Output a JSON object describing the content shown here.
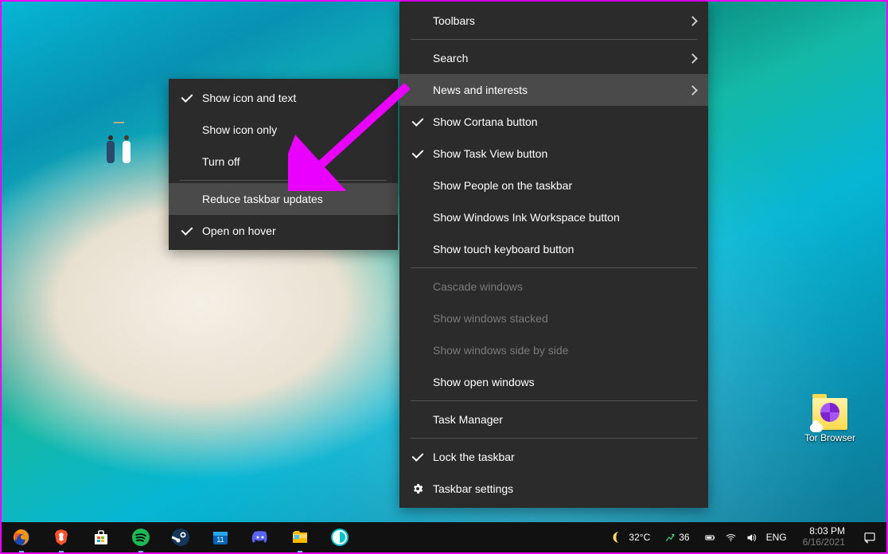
{
  "desktop": {
    "icon_label": "Tor Browser"
  },
  "submenu": {
    "items": [
      {
        "label": "Show icon and text",
        "checked": true
      },
      {
        "label": "Show icon only",
        "checked": false
      },
      {
        "label": "Turn off",
        "checked": false
      }
    ],
    "reduce": "Reduce taskbar updates",
    "hover": "Open on hover"
  },
  "mainmenu": {
    "toolbars": "Toolbars",
    "search": "Search",
    "news": "News and interests",
    "cortana": "Show Cortana button",
    "taskview": "Show Task View button",
    "people": "Show People on the taskbar",
    "ink": "Show Windows Ink Workspace button",
    "touch": "Show touch keyboard button",
    "cascade": "Cascade windows",
    "stacked": "Show windows stacked",
    "sidebyside": "Show windows side by side",
    "openwin": "Show open windows",
    "taskmgr": "Task Manager",
    "lock": "Lock the taskbar",
    "settings": "Taskbar settings"
  },
  "taskbar": {
    "weather_temp": "32°C",
    "stock_val": "36",
    "lang": "ENG",
    "time": "8:03 PM",
    "date": "6/16/2021"
  },
  "annotation": {
    "arrow_color": "#e900ff"
  }
}
